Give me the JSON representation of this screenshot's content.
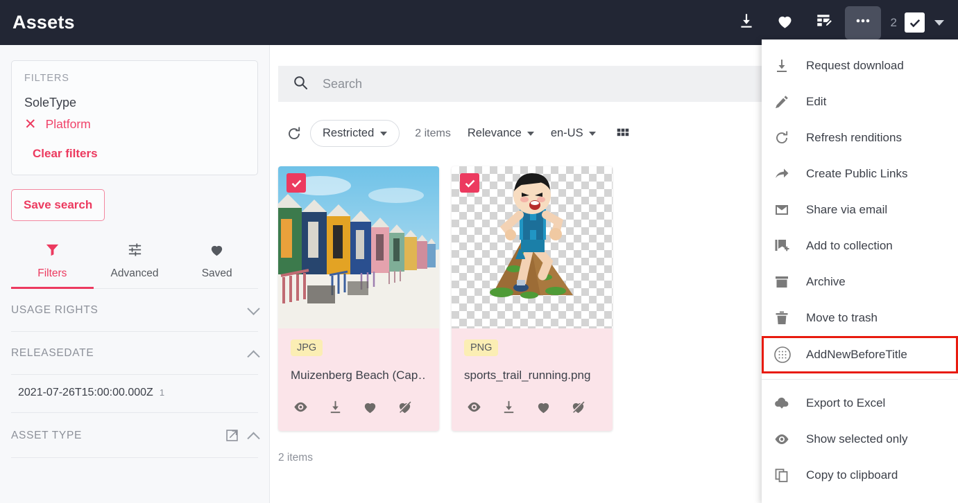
{
  "header": {
    "title": "Assets",
    "selected_count": "2",
    "actions": [
      {
        "name": "download-icon",
        "label": "Download"
      },
      {
        "name": "heart-icon",
        "label": "Favorite"
      },
      {
        "name": "edit-metadata-icon",
        "label": "Edit metadata"
      },
      {
        "name": "more-options-icon",
        "label": "More options"
      }
    ]
  },
  "sidebar": {
    "filters_card": {
      "heading": "FILTERS",
      "group_name": "SoleType",
      "chip_label": "Platform",
      "clear_label": "Clear filters"
    },
    "save_search_label": "Save search",
    "tabs": [
      {
        "label": "Filters",
        "icon": "funnel-icon",
        "active": true
      },
      {
        "label": "Advanced",
        "icon": "sliders-icon",
        "active": false
      },
      {
        "label": "Saved",
        "icon": "heart-icon",
        "active": false
      }
    ],
    "facets": [
      {
        "title": "USAGE RIGHTS",
        "state": "collapsed"
      },
      {
        "title": "RELEASEDATE",
        "state": "expanded"
      },
      {
        "title": "ASSET TYPE",
        "state": "expanded"
      }
    ],
    "release_date": {
      "value": "2021-07-26T15:00:00.000Z",
      "count": "1"
    }
  },
  "main": {
    "search": {
      "placeholder": "Search",
      "value": ""
    },
    "toolbar": {
      "restricted_label": "Restricted",
      "items_label": "2 items",
      "sort_label": "Relevance",
      "locale_label": "en-US"
    },
    "cards": [
      {
        "format": "JPG",
        "title": "Muizenberg Beach (Cap…",
        "selected": true,
        "thumb_kind": "photo-beach-huts",
        "icons": [
          "eye-icon",
          "download-icon",
          "heart-icon",
          "heart-slash-icon"
        ]
      },
      {
        "format": "PNG",
        "title": "sports_trail_running.png",
        "selected": true,
        "thumb_kind": "illustration-trail-runner",
        "icons": [
          "eye-icon",
          "download-icon",
          "heart-icon",
          "heart-slash-icon"
        ]
      }
    ],
    "footer_count": "2 items"
  },
  "menu": {
    "items": [
      {
        "label": "Request download",
        "icon": "download-icon",
        "highlighted": false
      },
      {
        "label": "Edit",
        "icon": "pencil-icon",
        "highlighted": false
      },
      {
        "label": "Refresh renditions",
        "icon": "refresh-icon",
        "highlighted": false
      },
      {
        "label": "Create Public Links",
        "icon": "share-arrow-icon",
        "highlighted": false
      },
      {
        "label": "Share via email",
        "icon": "envelope-icon",
        "highlighted": false
      },
      {
        "label": "Add to collection",
        "icon": "add-collection-icon",
        "highlighted": false
      },
      {
        "label": "Archive",
        "icon": "archive-icon",
        "highlighted": false
      },
      {
        "label": "Move to trash",
        "icon": "trash-icon",
        "highlighted": false
      },
      {
        "label": "AddNewBeforeTitle",
        "icon": "dotted-circle-icon",
        "highlighted": true
      },
      {
        "label": "Export to Excel",
        "icon": "cloud-download-icon",
        "highlighted": false
      },
      {
        "label": "Show selected only",
        "icon": "eye-icon",
        "highlighted": false
      },
      {
        "label": "Copy to clipboard",
        "icon": "copy-icon",
        "highlighted": false
      }
    ]
  },
  "colors": {
    "header_bg": "#222634",
    "accent_pink": "#ec3a5f",
    "card_bg": "#fbe4e9",
    "badge_bg": "#fbeeb4",
    "highlight_red": "#e81b0f"
  }
}
